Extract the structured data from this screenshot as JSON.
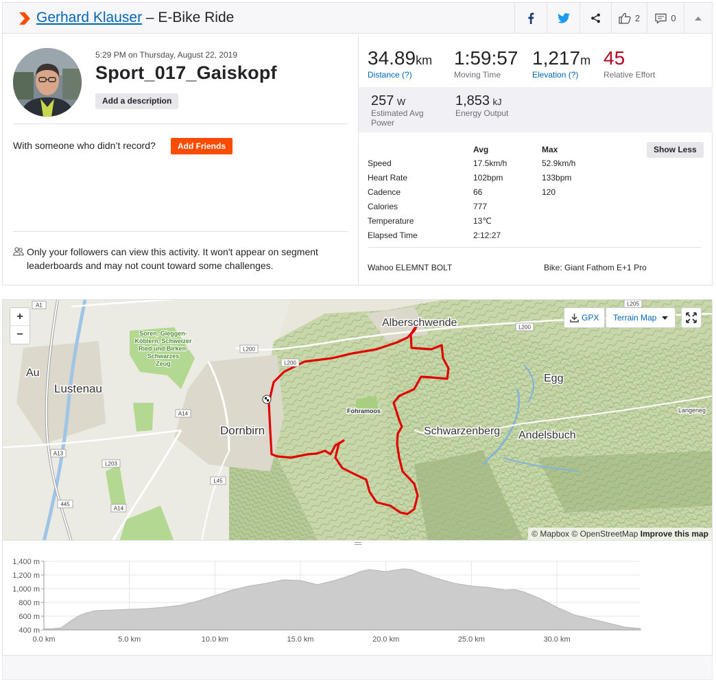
{
  "header": {
    "athlete_name": "Gerhard Klauser",
    "title_suffix": " – E-Bike Ride",
    "kudos_count": "2",
    "comment_count": "0"
  },
  "summary": {
    "datetime": "5:29 PM on Thursday, August 22, 2019",
    "activity_name": "Sport_017_Gaiskopf",
    "add_description": "Add a description",
    "with_someone": "With someone who didn’t record?",
    "add_friends": "Add Friends",
    "privacy_note": "Only your followers can view this activity. It won't appear on segment leaderboards and may not count toward some challenges."
  },
  "stats": {
    "primary": [
      {
        "value": "34.89",
        "unit": "km",
        "label": "Distance (?)",
        "link": true,
        "color": "#242428"
      },
      {
        "value": "1:59:57",
        "unit": "",
        "label": "Moving Time",
        "link": false,
        "color": "#242428"
      },
      {
        "value": "1,217",
        "unit": "m",
        "label": "Elevation (?)",
        "link": true,
        "color": "#242428"
      },
      {
        "value": "45",
        "unit": "",
        "label": "Relative Effort",
        "link": false,
        "color": "#b8001f"
      }
    ],
    "secondary": [
      {
        "value": "257",
        "unit": "W",
        "label": "Estimated Avg Power"
      },
      {
        "value": "1,853",
        "unit": "kJ",
        "label": "Energy Output"
      }
    ],
    "show_less": "Show Less",
    "table_headers": {
      "avg": "Avg",
      "max": "Max"
    },
    "rows": [
      {
        "label": "Speed",
        "avg": "17.5km/h",
        "max": "52.9km/h"
      },
      {
        "label": "Heart Rate",
        "avg": "102bpm",
        "max": "133bpm"
      },
      {
        "label": "Cadence",
        "avg": "66",
        "max": "120"
      },
      {
        "label": "Calories",
        "avg": "777",
        "max": ""
      },
      {
        "label": "Temperature",
        "avg": "13℃",
        "max": ""
      },
      {
        "label": "Elapsed Time",
        "avg": "2:12:27",
        "max": ""
      }
    ],
    "device": "Wahoo ELEMNT BOLT",
    "bike": "Bike: Giant Fathom E+1 Pro"
  },
  "map": {
    "zoom_in": "+",
    "zoom_out": "−",
    "gpx": "GPX",
    "terrain": "Terrain Map",
    "attribution": {
      "mapbox": "© Mapbox",
      "osm": "© OpenStreetMap",
      "improve": "Improve this map"
    },
    "places": {
      "alberschwende": "Alberschwende",
      "egg": "Egg",
      "au": "Au",
      "lustenau": "Lustenau",
      "dornbirn": "Dornbirn",
      "schwarzenberg": "Schwarzenberg",
      "andelsbuch": "Andelsbuch",
      "fohramoos": "Fohramoos",
      "langenegg": "Langeneg",
      "reserve_1": "Soren, Gleggen-",
      "reserve_2": "Köblern, Schweizer",
      "reserve_3": "Ried und Birken-",
      "reserve_4": "Schwarzes",
      "reserve_5": "Zeug"
    },
    "roads": [
      "A1",
      "L205",
      "L200",
      "L200",
      "L200",
      "A14",
      "A13",
      "L203",
      "L45",
      "445",
      "A14"
    ],
    "route_color": "#e00000"
  },
  "chart_data": {
    "type": "area",
    "xlabel": "",
    "ylabel": "",
    "x_ticks": [
      "0.0 km",
      "5.0 km",
      "10.0 km",
      "15.0 km",
      "20.0 km",
      "25.0 km",
      "30.0 km"
    ],
    "y_ticks": [
      "400 m",
      "600 m",
      "800 m",
      "1,000 m",
      "1,200 m",
      "1,400 m"
    ],
    "xlim": [
      0,
      34.89
    ],
    "ylim": [
      400,
      1400
    ],
    "grid": true,
    "color": "#cccccc",
    "x": [
      0,
      0.5,
      1,
      1.5,
      2,
      2.5,
      3,
      4,
      5,
      6,
      7,
      8,
      9,
      10,
      11,
      12,
      13,
      14,
      15,
      16,
      17,
      17.5,
      18,
      18.5,
      19,
      20,
      20.5,
      21,
      21.5,
      22,
      23,
      24,
      25,
      26,
      27,
      27.5,
      28,
      29,
      30,
      31,
      32,
      33,
      34,
      34.89
    ],
    "y": [
      415,
      418,
      430,
      520,
      600,
      650,
      680,
      690,
      700,
      710,
      730,
      760,
      820,
      900,
      980,
      1040,
      1080,
      1130,
      1120,
      1060,
      1120,
      1160,
      1200,
      1250,
      1280,
      1250,
      1270,
      1290,
      1280,
      1230,
      1150,
      1080,
      1040,
      1020,
      980,
      990,
      960,
      860,
      730,
      620,
      560,
      500,
      440,
      420
    ]
  }
}
